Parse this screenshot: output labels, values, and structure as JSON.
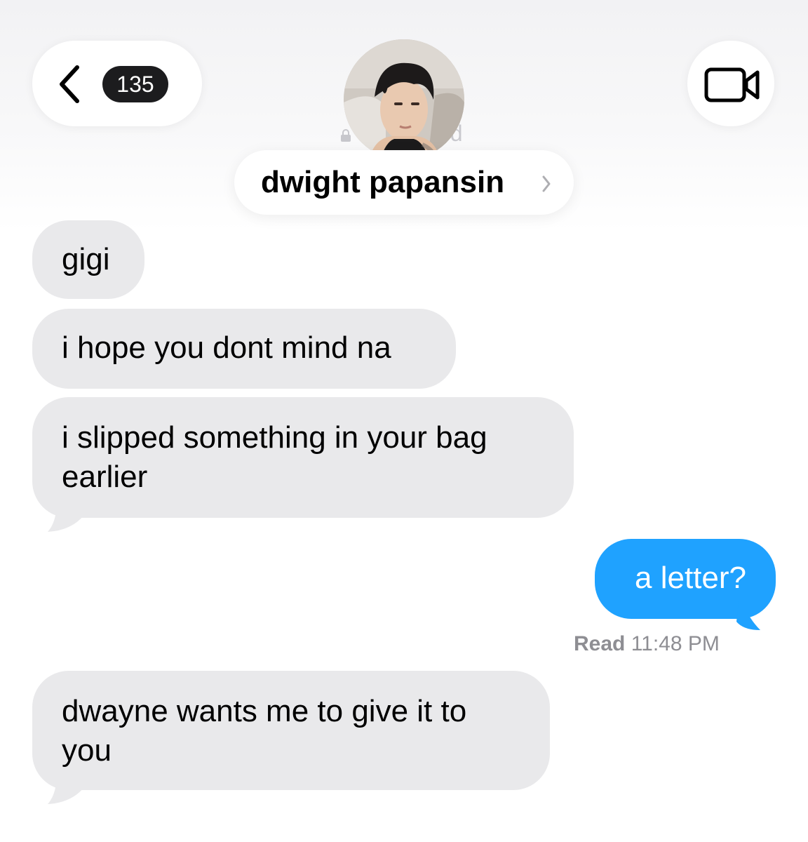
{
  "header": {
    "back_count": "135",
    "ghost_suffix": "ed",
    "contact_name": "dwight papansin"
  },
  "messages": [
    {
      "direction": "incoming",
      "text": "gigi"
    },
    {
      "direction": "incoming",
      "text": "i hope you dont mind na"
    },
    {
      "direction": "incoming",
      "lines": [
        "i slipped something in your bag",
        "earlier"
      ]
    },
    {
      "direction": "outgoing",
      "text": "a letter?"
    },
    {
      "direction": "incoming",
      "lines": [
        "dwayne wants me to give it to",
        "you"
      ]
    }
  ],
  "receipt": {
    "label": "Read",
    "time": "11:48 PM"
  },
  "colors": {
    "incoming_bubble": "#e9e9eb",
    "outgoing_bubble": "#1fa2ff",
    "badge": "#1c1c1e",
    "receipt_text": "#8e8e93"
  },
  "icons": [
    "chevron-left-icon",
    "video-camera-icon",
    "chevron-right-icon",
    "lock-icon"
  ]
}
